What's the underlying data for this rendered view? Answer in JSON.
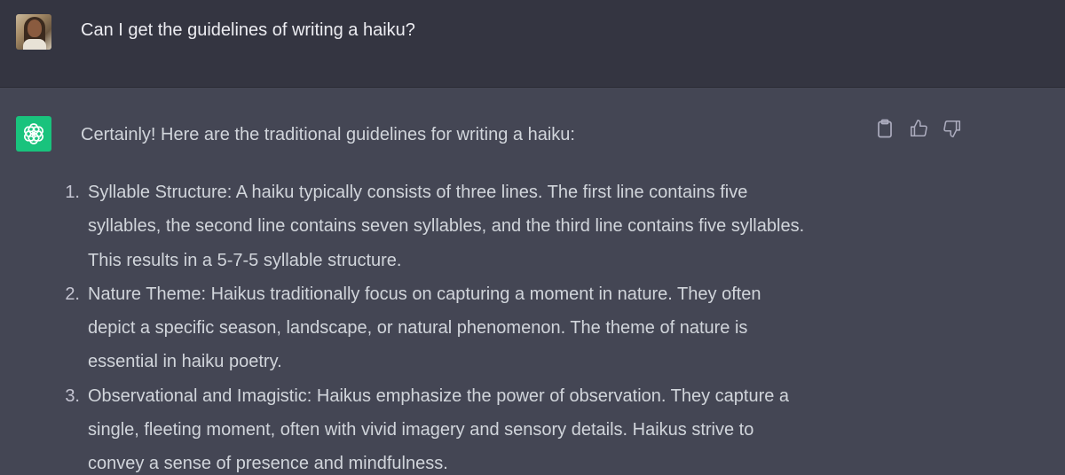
{
  "user": {
    "avatar_icon": "user-photo-avatar",
    "message": "Can I get the guidelines of writing a haiku?"
  },
  "assistant": {
    "avatar_icon": "openai-logo-icon",
    "intro": "Certainly! Here are the traditional guidelines for writing a haiku:",
    "actions": [
      {
        "icon": "clipboard-icon"
      },
      {
        "icon": "thumbs-up-icon"
      },
      {
        "icon": "thumbs-down-icon"
      }
    ],
    "guidelines": [
      {
        "number": "1.",
        "lines": [
          "Syllable Structure: A haiku typically consists of three lines. The first line contains five",
          "syllables, the second line contains seven syllables, and the third line contains five syllables.",
          "This results in a 5-7-5 syllable structure."
        ]
      },
      {
        "number": "2.",
        "lines": [
          "Nature Theme: Haikus traditionally focus on capturing a moment in nature. They often",
          "depict a specific season, landscape, or natural phenomenon. The theme of nature is",
          "essential in haiku poetry."
        ]
      },
      {
        "number": "3.",
        "lines": [
          "Observational and Imagistic: Haikus emphasize the power of observation. They capture a",
          "single, fleeting moment, often with vivid imagery and sensory details. Haikus strive to",
          "convey a sense of presence and mindfulness."
        ]
      }
    ]
  },
  "colors": {
    "user_background": "#343541",
    "assistant_background": "#444654",
    "assistant_avatar": "#19c37d"
  }
}
